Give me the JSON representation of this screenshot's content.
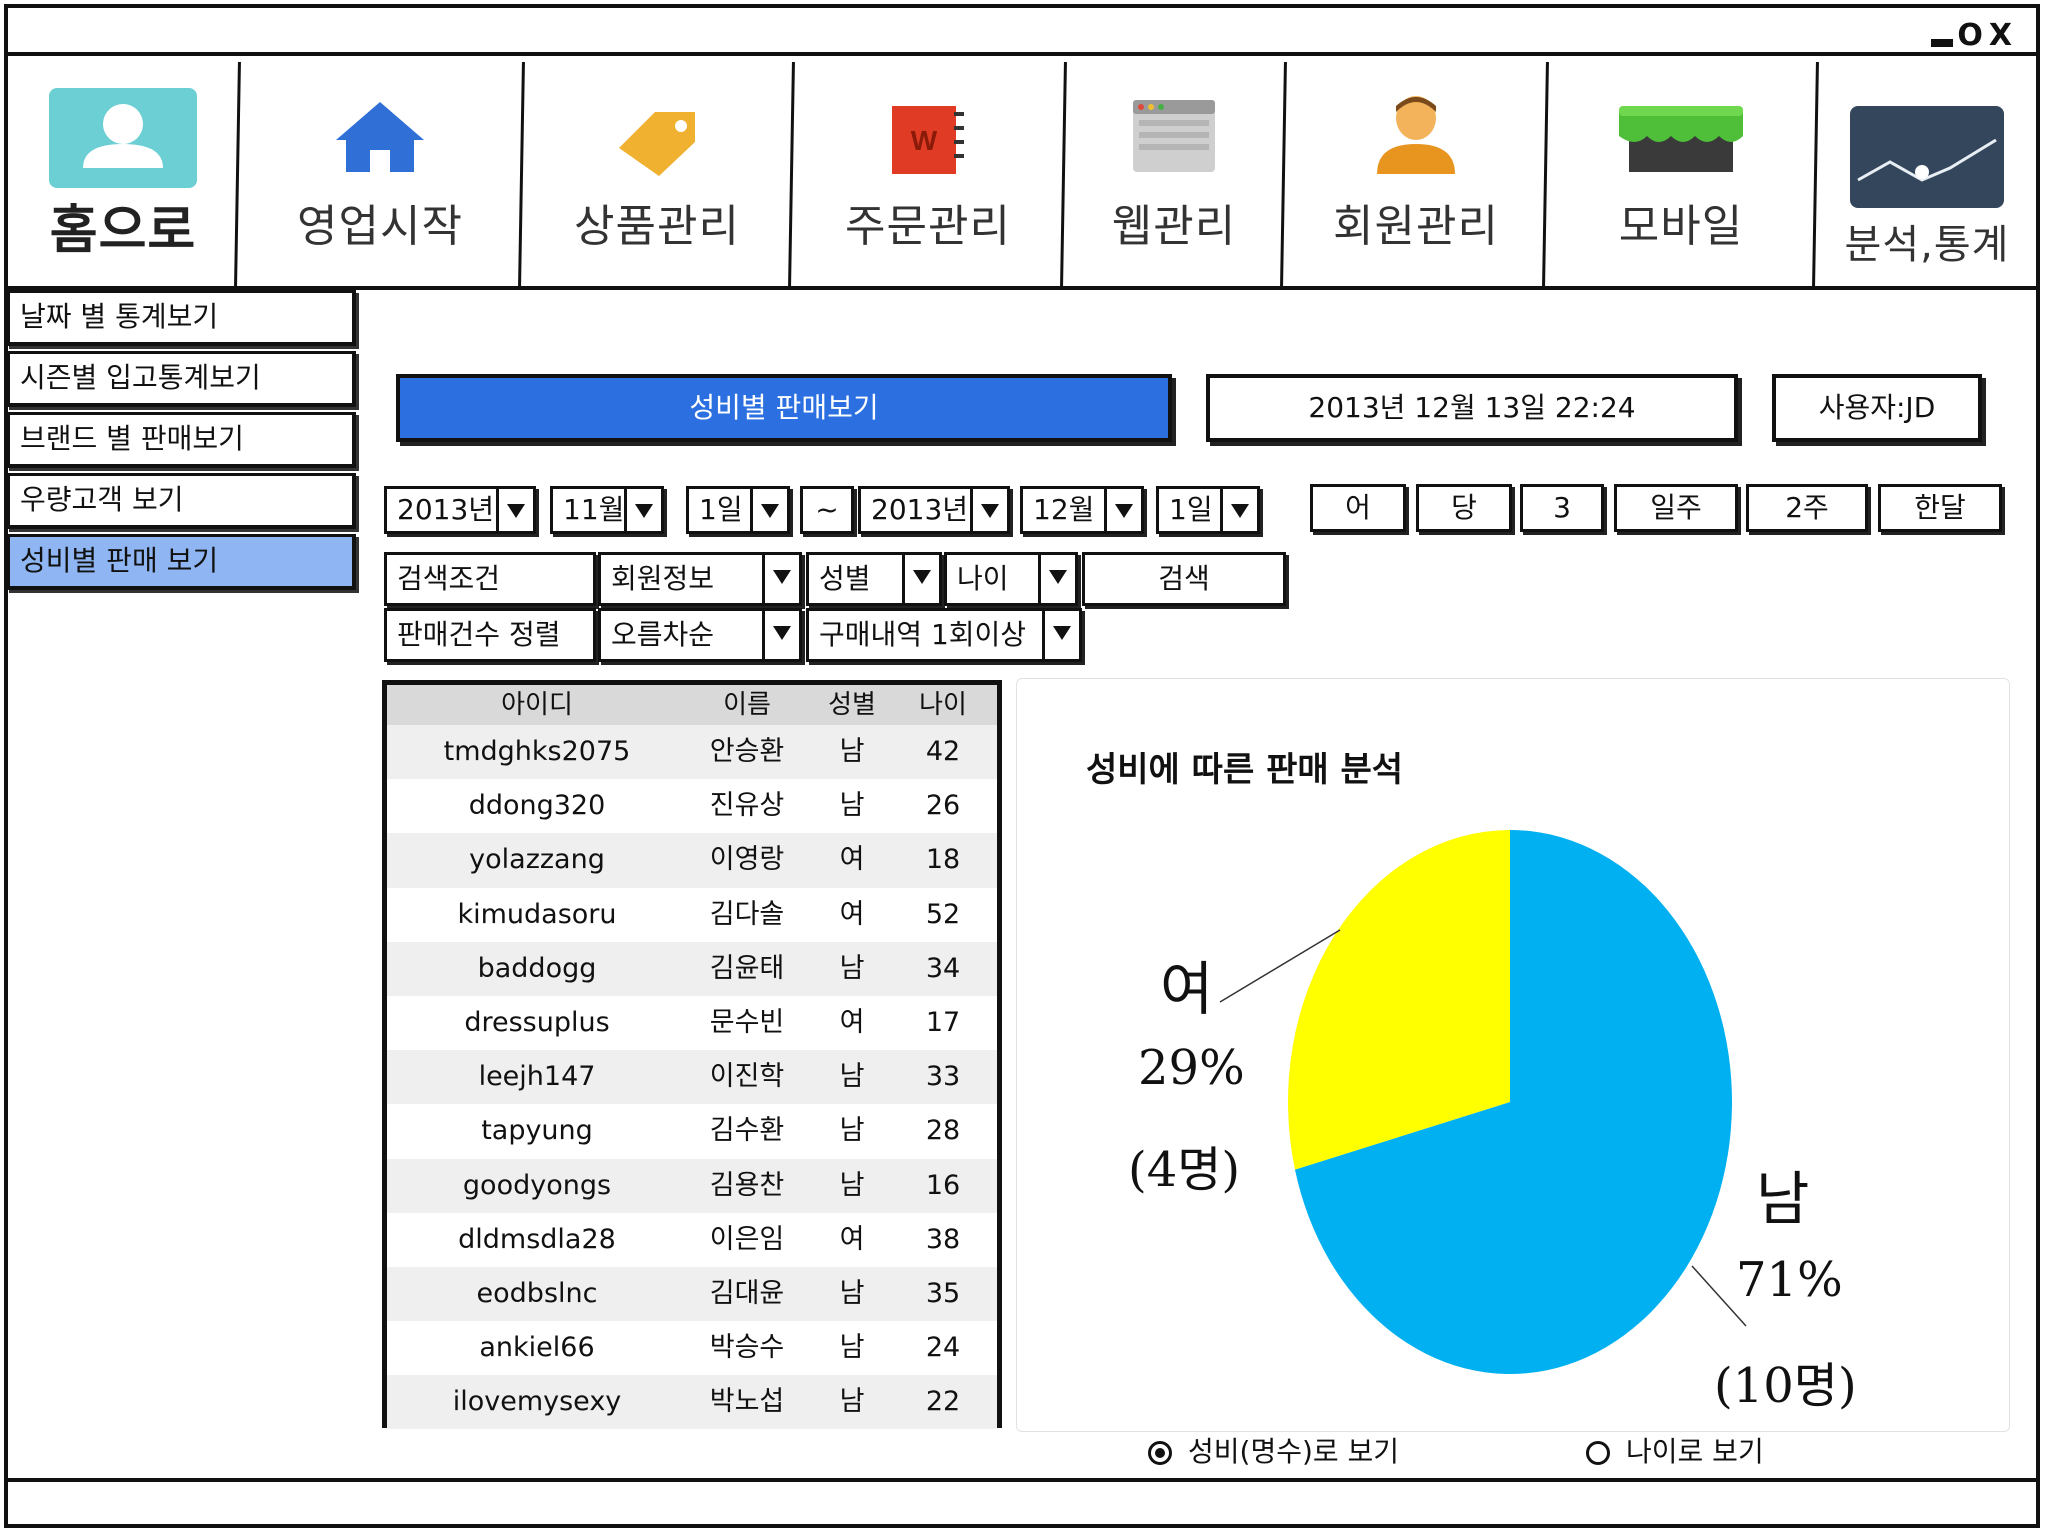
{
  "window": {
    "controls": [
      "_",
      "O",
      "X"
    ]
  },
  "nav": [
    {
      "label": "홈으로",
      "icon": "user-icon"
    },
    {
      "label": "영업시작",
      "icon": "home-icon"
    },
    {
      "label": "상품관리",
      "icon": "tag-icon"
    },
    {
      "label": "주문관리",
      "icon": "won-notebook-icon"
    },
    {
      "label": "웹관리",
      "icon": "browser-window-icon"
    },
    {
      "label": "회원관리",
      "icon": "member-icon"
    },
    {
      "label": "모바일",
      "icon": "store-icon"
    },
    {
      "label": "분석,통계",
      "icon": "line-chart-icon"
    }
  ],
  "sidebar": {
    "items": [
      {
        "label": "날짜 별 통계보기"
      },
      {
        "label": "시즌별 입고통계보기"
      },
      {
        "label": "브랜드 별 판매보기"
      },
      {
        "label": "우량고객 보기"
      },
      {
        "label": "성비별 판매 보기",
        "active": true
      }
    ]
  },
  "header": {
    "title": "성비별 판매보기",
    "datetime": "2013년 12월 13일 22:24",
    "user": "사용자:JD"
  },
  "date_range": {
    "from_year": "2013년",
    "from_month": "11월",
    "from_day": "1일",
    "separator": "~",
    "to_year": "2013년",
    "to_month": "12월",
    "to_day": "1일"
  },
  "quick_range": [
    "어",
    "당",
    "3",
    "일주",
    "2주",
    "한달"
  ],
  "filters": {
    "condition_label": "검색조건",
    "member_info": "회원정보",
    "gender": "성별",
    "age": "나이",
    "search_button": "검색",
    "sort_label": "판매건수 정렬",
    "sort_order": "오름차순",
    "purchase": "구매내역 1회이상"
  },
  "table": {
    "columns": [
      "아이디",
      "이름",
      "성별",
      "나이"
    ],
    "rows": [
      [
        "tmdghks2075",
        "안승환",
        "남",
        "42"
      ],
      [
        "ddong320",
        "진유상",
        "남",
        "26"
      ],
      [
        "yolazzang",
        "이영랑",
        "여",
        "18"
      ],
      [
        "kimudasoru",
        "김다솔",
        "여",
        "52"
      ],
      [
        "baddogg",
        "김윤태",
        "남",
        "34"
      ],
      [
        "dressuplus",
        "문수빈",
        "여",
        "17"
      ],
      [
        "leejh147",
        "이진학",
        "남",
        "33"
      ],
      [
        "tapyung",
        "김수환",
        "남",
        "28"
      ],
      [
        "goodyongs",
        "김용찬",
        "남",
        "16"
      ],
      [
        "dldmsdla28",
        "이은임",
        "여",
        "38"
      ],
      [
        "eodbslnc",
        "김대윤",
        "남",
        "35"
      ],
      [
        "ankiel66",
        "박승수",
        "남",
        "24"
      ],
      [
        "ilovemysexy",
        "박노섭",
        "남",
        "22"
      ]
    ]
  },
  "chart_data": {
    "type": "pie",
    "title": "성비에 따른 판매 분석",
    "slices": [
      {
        "label": "남",
        "percent": 71,
        "count_label": "(10명)",
        "percent_label": "71%",
        "color": "#00b0f0"
      },
      {
        "label": "여",
        "percent": 29,
        "count_label": "(4명)",
        "percent_label": "29%",
        "color": "#ffff00"
      }
    ]
  },
  "view_options": [
    {
      "label": "성비(명수)로 보기",
      "selected": true
    },
    {
      "label": "나이로 보기",
      "selected": false
    }
  ]
}
